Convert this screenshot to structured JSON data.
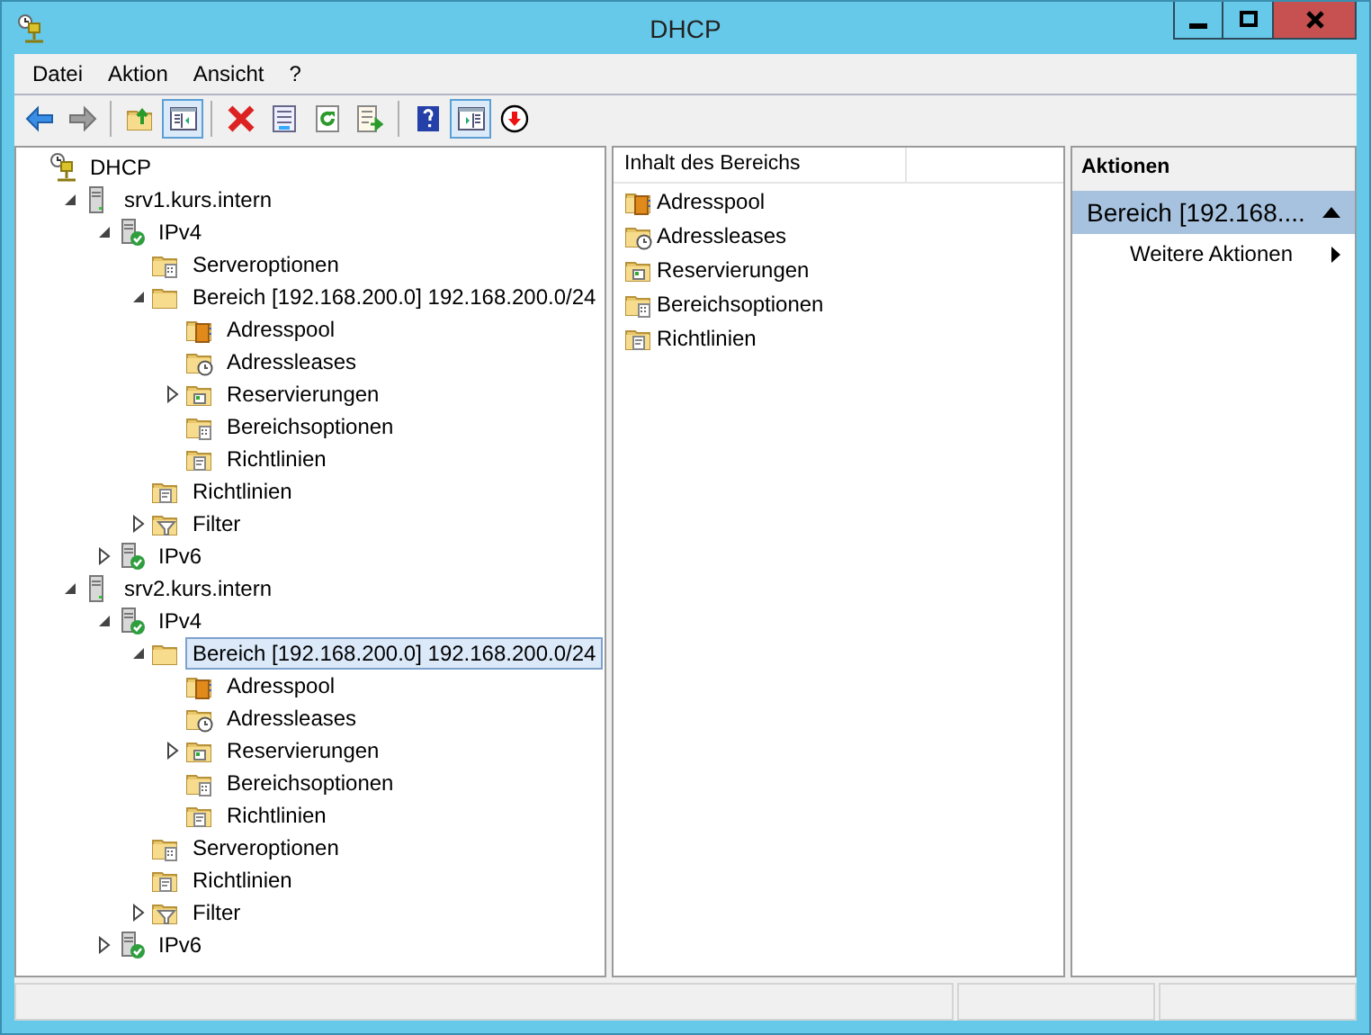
{
  "window": {
    "title": "DHCP"
  },
  "menu": [
    {
      "label": "Datei"
    },
    {
      "label": "Aktion"
    },
    {
      "label": "Ansicht"
    },
    {
      "label": "?"
    }
  ],
  "toolbar": [
    {
      "kind": "back",
      "disabled": false,
      "pressed": false
    },
    {
      "kind": "forward",
      "disabled": true,
      "pressed": false
    },
    {
      "kind": "separator"
    },
    {
      "kind": "up-folder",
      "disabled": false,
      "pressed": false
    },
    {
      "kind": "console-tree",
      "disabled": false,
      "pressed": true
    },
    {
      "kind": "separator"
    },
    {
      "kind": "delete",
      "disabled": false,
      "pressed": false
    },
    {
      "kind": "properties",
      "disabled": false,
      "pressed": false
    },
    {
      "kind": "refresh",
      "disabled": false,
      "pressed": false
    },
    {
      "kind": "export",
      "disabled": false,
      "pressed": false
    },
    {
      "kind": "separator"
    },
    {
      "kind": "help",
      "disabled": false,
      "pressed": false
    },
    {
      "kind": "action-pane",
      "disabled": false,
      "pressed": true
    },
    {
      "kind": "deactivate",
      "disabled": false,
      "pressed": false
    }
  ],
  "tree": [
    {
      "label": "DHCP",
      "kind": "dhcp",
      "selected": false,
      "children": [
        {
          "label": "srv1.kurs.intern",
          "kind": "server",
          "selected": false,
          "expanded": true,
          "children": [
            {
              "label": "IPv4",
              "kind": "protocol",
              "selected": false,
              "expanded": true,
              "children": [
                {
                  "label": "Serveroptionen",
                  "kind": "options",
                  "selected": false
                },
                {
                  "label": "Bereich [192.168.200.0] 192.168.200.0/24",
                  "kind": "scope",
                  "selected": false,
                  "expanded": true,
                  "children": [
                    {
                      "label": "Adresspool",
                      "kind": "pool",
                      "selected": false
                    },
                    {
                      "label": "Adressleases",
                      "kind": "leases",
                      "selected": false
                    },
                    {
                      "label": "Reservierungen",
                      "kind": "reservations",
                      "selected": false,
                      "expanded": false
                    },
                    {
                      "label": "Bereichsoptionen",
                      "kind": "options",
                      "selected": false
                    },
                    {
                      "label": "Richtlinien",
                      "kind": "policies",
                      "selected": false
                    }
                  ]
                },
                {
                  "label": "Richtlinien",
                  "kind": "policies",
                  "selected": false
                },
                {
                  "label": "Filter",
                  "kind": "filter",
                  "selected": false,
                  "expanded": false
                }
              ]
            },
            {
              "label": "IPv6",
              "kind": "protocol",
              "selected": false,
              "expanded": false
            }
          ]
        },
        {
          "label": "srv2.kurs.intern",
          "kind": "server",
          "selected": false,
          "expanded": true,
          "children": [
            {
              "label": "IPv4",
              "kind": "protocol",
              "selected": false,
              "expanded": true,
              "children": [
                {
                  "label": "Bereich [192.168.200.0] 192.168.200.0/24",
                  "kind": "scope",
                  "selected": true,
                  "expanded": true,
                  "children": [
                    {
                      "label": "Adresspool",
                      "kind": "pool",
                      "selected": false
                    },
                    {
                      "label": "Adressleases",
                      "kind": "leases",
                      "selected": false
                    },
                    {
                      "label": "Reservierungen",
                      "kind": "reservations",
                      "selected": false,
                      "expanded": false
                    },
                    {
                      "label": "Bereichsoptionen",
                      "kind": "options",
                      "selected": false
                    },
                    {
                      "label": "Richtlinien",
                      "kind": "policies",
                      "selected": false
                    }
                  ]
                },
                {
                  "label": "Serveroptionen",
                  "kind": "options",
                  "selected": false
                },
                {
                  "label": "Richtlinien",
                  "kind": "policies",
                  "selected": false
                },
                {
                  "label": "Filter",
                  "kind": "filter",
                  "selected": false,
                  "expanded": false
                }
              ]
            },
            {
              "label": "IPv6",
              "kind": "protocol",
              "selected": false,
              "expanded": false
            }
          ]
        }
      ]
    }
  ],
  "content": {
    "column": "Inhalt des Bereichs",
    "items": [
      {
        "label": "Adresspool",
        "kind": "pool"
      },
      {
        "label": "Adressleases",
        "kind": "leases"
      },
      {
        "label": "Reservierungen",
        "kind": "reservations"
      },
      {
        "label": "Bereichsoptionen",
        "kind": "options"
      },
      {
        "label": "Richtlinien",
        "kind": "policies"
      }
    ]
  },
  "actions": {
    "title": "Aktionen",
    "section": {
      "label": "Bereich [192.168....",
      "expanded": true
    },
    "items": [
      {
        "label": "Weitere Aktionen"
      }
    ]
  }
}
